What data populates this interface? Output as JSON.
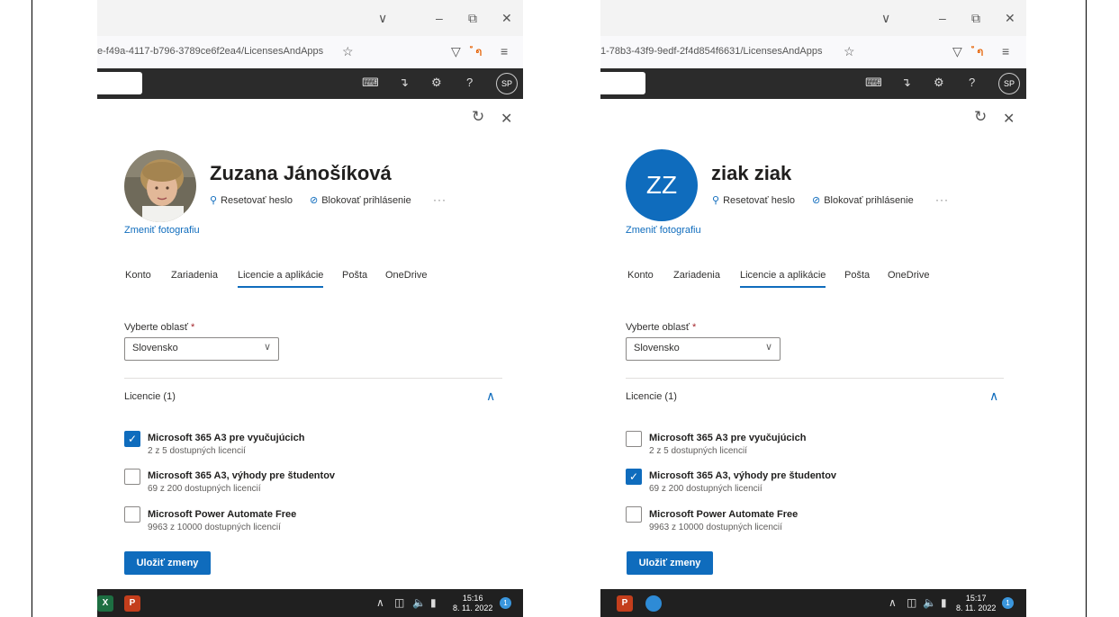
{
  "window_controls": {
    "chevron": "∨",
    "minimize": "–",
    "restore": "⧉",
    "close": "✕"
  },
  "toolbar_icons": {
    "star": "☆",
    "pocket": "▽",
    "rss": "ຳ",
    "menu": "≡"
  },
  "m365_icons": {
    "console": "⌨",
    "whatsnew": "↴",
    "settings": "⚙",
    "help": "?"
  },
  "panel_icons": {
    "refresh": "↻",
    "close": "✕",
    "dropdown_chevron": "∨",
    "collapse_chevron": "∧",
    "checkmark": "✓"
  },
  "accent_color": "#0f6cbd",
  "taskbar_icons": {
    "excel": "X",
    "powerpoint": "P",
    "up_arrow": "∧"
  },
  "screens": [
    {
      "url": "e-f49a-4117-b796-3789ce6f2ea4/LicensesAndApps",
      "avatar_initials": "SP",
      "user": {
        "name": "Zuzana Jánošíková",
        "photo_type": "photo"
      },
      "actions": {
        "reset_password": "Resetovať heslo",
        "block_signin": "Blokovať prihlásenie",
        "more": "···"
      },
      "change_photo": "Zmeniť fotografiu",
      "tabs": [
        "Konto",
        "Zariadenia",
        "Licencie a aplikácie",
        "Pošta",
        "OneDrive"
      ],
      "active_tab": 2,
      "region_label": "Vyberte oblasť",
      "required_mark": "*",
      "region_value": "Slovensko",
      "licenses_header": "Licencie (1)",
      "licenses": [
        {
          "name": "Microsoft 365 A3 pre vyučujúcich",
          "available": "2 z 5 dostupných licencií",
          "checked": true
        },
        {
          "name": "Microsoft 365 A3, výhody pre študentov",
          "available": "69 z 200 dostupných licencií",
          "checked": false
        },
        {
          "name": "Microsoft Power Automate Free",
          "available": "9963 z 10000 dostupných licencií",
          "checked": false
        }
      ],
      "save_label": "Uložiť zmeny",
      "time": "15:16",
      "date": "8. 11. 2022",
      "notification_count": "1"
    },
    {
      "url": "1-78b3-43f9-9edf-2f4d854f6631/LicensesAndApps",
      "avatar_initials": "SP",
      "user": {
        "name": "ziak ziak",
        "photo_type": "initials",
        "initials": "ZZ"
      },
      "actions": {
        "reset_password": "Resetovať heslo",
        "block_signin": "Blokovať prihlásenie",
        "more": "···"
      },
      "change_photo": "Zmeniť fotografiu",
      "tabs": [
        "Konto",
        "Zariadenia",
        "Licencie a aplikácie",
        "Pošta",
        "OneDrive"
      ],
      "active_tab": 2,
      "region_label": "Vyberte oblasť",
      "required_mark": "*",
      "region_value": "Slovensko",
      "licenses_header": "Licencie (1)",
      "licenses": [
        {
          "name": "Microsoft 365 A3 pre vyučujúcich",
          "available": "2 z 5 dostupných licencií",
          "checked": false
        },
        {
          "name": "Microsoft 365 A3, výhody pre študentov",
          "available": "69 z 200 dostupných licencií",
          "checked": true
        },
        {
          "name": "Microsoft Power Automate Free",
          "available": "9963 z 10000 dostupných licencií",
          "checked": false
        }
      ],
      "save_label": "Uložiť zmeny",
      "time": "15:17",
      "date": "8. 11. 2022",
      "notification_count": "1"
    }
  ]
}
